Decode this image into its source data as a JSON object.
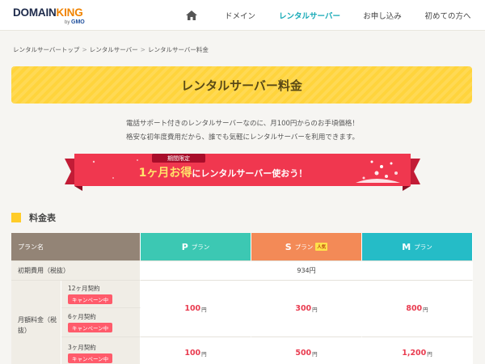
{
  "header": {
    "logo_main_a": "DOMAIN",
    "logo_main_b": "KING",
    "logo_sub_prefix": "by",
    "logo_sub_brand": "GMO",
    "nav": [
      {
        "label": "ドメイン"
      },
      {
        "label": "レンタルサーバー",
        "active": true
      },
      {
        "label": "お申し込み"
      },
      {
        "label": "初めての方へ"
      }
    ]
  },
  "breadcrumb": [
    "レンタルサーバートップ",
    "レンタルサーバー",
    "レンタルサーバー料金"
  ],
  "page_title": "レンタルサーバー料金",
  "intro": [
    "電話サポート付きのレンタルサーバーなのに、月100円からのお手頃価格！",
    "格安な初年度費用だから、誰でも気軽にレンタルサーバーを利用できます。"
  ],
  "campaign": {
    "tag": "期間限定",
    "main_big": "1ヶ月お得",
    "main_small": "にレンタルサーバー使おう！"
  },
  "section_title": "料金表",
  "table": {
    "plan_header": "プラン名",
    "plans": [
      {
        "letter": "P",
        "word": "プラン"
      },
      {
        "letter": "S",
        "word": "プラン",
        "badge": "人気"
      },
      {
        "letter": "M",
        "word": "プラン"
      }
    ],
    "initial_label": "初期費用（税抜）",
    "initial_value": "934円",
    "monthly_label": "月額料金（税抜）",
    "terms": [
      {
        "label": "12ヶ月契約",
        "badge": "キャンペーン中"
      },
      {
        "label": "6ヶ月契約",
        "badge": "キャンペーン中"
      },
      {
        "label": "3ヶ月契約",
        "badge": "キャンペーン中"
      }
    ],
    "prices_12_6": [
      {
        "value": "100",
        "unit": "円"
      },
      {
        "value": "300",
        "unit": "円"
      },
      {
        "value": "800",
        "unit": "円"
      }
    ],
    "prices_3": [
      {
        "value": "100",
        "unit": "円"
      },
      {
        "value": "500",
        "unit": "円"
      },
      {
        "value": "1,200",
        "unit": "円"
      }
    ]
  },
  "colors": {
    "accent_teal": "#16a9b6",
    "title_yellow": "#ffd43c",
    "ribbon_red": "#f0374f",
    "plan_p": "#3cc8b3",
    "plan_s": "#f38a57",
    "plan_m": "#25bcc7",
    "price_red": "#e93c50"
  }
}
